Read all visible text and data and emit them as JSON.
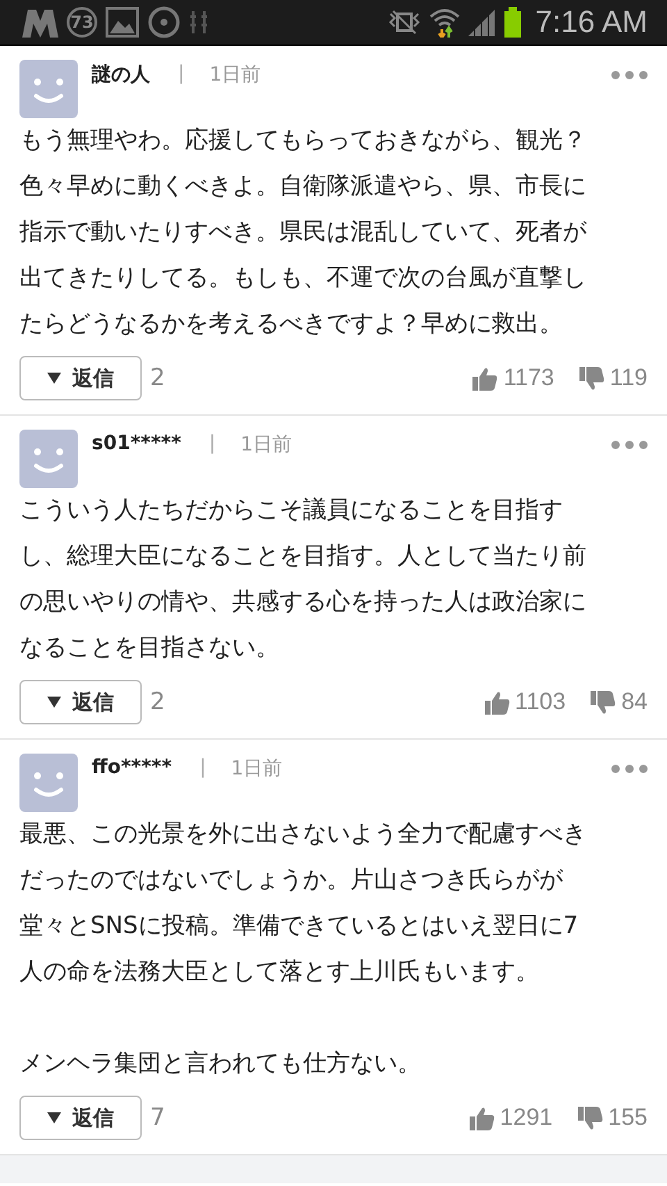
{
  "status_bar": {
    "notification_count": "73",
    "time": "7:16 AM"
  },
  "comments": [
    {
      "author": "謎の人",
      "separator": "|",
      "time": "1日前",
      "paragraphs": [
        [
          "もう無理やわ。応援してもらっておきながら、観光？",
          "色々早めに動くべきよ。自衛隊派遣やら、県、市長に",
          "指示で動いたりすべき。県民は混乱していて、死者が",
          "出てきたりしてる。もしも、不運で次の台風が直撃し",
          "たらどうなるかを考えるべきですよ？早めに救出。"
        ]
      ],
      "reply_label": "返信",
      "reply_count": "2",
      "likes": "1173",
      "dislikes": "119"
    },
    {
      "author": "s01*****",
      "separator": "|",
      "time": "1日前",
      "paragraphs": [
        [
          "こういう人たちだからこそ議員になることを目指す",
          "し、総理大臣になることを目指す。人として当たり前",
          "の思いやりの情や、共感する心を持った人は政治家に",
          "なることを目指さない。"
        ]
      ],
      "reply_label": "返信",
      "reply_count": "2",
      "likes": "1103",
      "dislikes": "84"
    },
    {
      "author": "ffo*****",
      "separator": "|",
      "time": "1日前",
      "paragraphs": [
        [
          "最悪、この光景を外に出さないよう全力で配慮すべき",
          "だったのではないでしょうか。片山さつき氏らがが",
          "堂々とSNSに投稿。準備できているとはいえ翌日に7",
          "人の命を法務大臣として落とす上川氏もいます。"
        ],
        [
          "メンヘラ集団と言われても仕方ない。"
        ]
      ],
      "reply_label": "返信",
      "reply_count": "7",
      "likes": "1291",
      "dislikes": "155"
    }
  ]
}
